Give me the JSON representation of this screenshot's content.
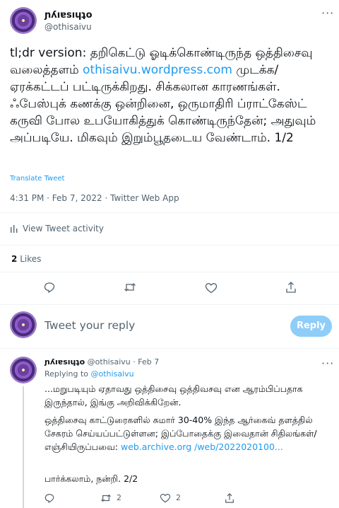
{
  "tweet": {
    "author_name": "ɲʎıɐsıɥʇo",
    "author_handle": "@othisaivu",
    "text_before_link": "tl;dr version: தறிகெட்டு ஓடிக்கொண்டிருந்த ஒத்திசைவு வலைத்தளம் ",
    "link": "othisaivu.wordpress.com",
    "text_after_link": " முடக்க/ஏரக்கட்டப் பட்டிருக்கிறது. சிக்கலான காரணங்கள். ஃபேஸ்புக் கணக்கு ஒன்றினை, ஒருமாதிரி ப்ராட்கேஸ்ட் கருவி போல உபயோகித்துக் கொண்டிருந்தேன்; அதுவும் அப்படியே. மிகவும் இறும்பூதடைய வேண்டாம். 1/2",
    "translate": "Translate Tweet",
    "meta": "4:31 PM · Feb 7, 2022 · Twitter Web App",
    "view_activity": "View Tweet activity",
    "likes_count": "2",
    "likes_label": "Likes"
  },
  "compose": {
    "placeholder": "Tweet your reply",
    "reply_button": "Reply"
  },
  "reply": {
    "author_name": "ɲʎıɐsıɥʇo",
    "author_handle": "@othisaivu",
    "date": "· Feb 7",
    "replying_to_label": "Replying to",
    "replying_to_handle": "@othisaivu",
    "para1": "...மறுபடியும் ஏதாவது ஒத்திசைவு ஒத்திவசவு என ஆரம்பிப்பதாக இருந்தால், இங்கு அறிவிக்கிறேன்.",
    "para2_before_link": "ஒத்திசைவு காட்டுரைகளில் சுமார் 30-40% இந்த ஆர்கைவ் தளத்தில் சேகரம் செய்யப்பட்டுள்ளன; இப்போதைக்கு இவைதான் சிதிலங்கள்/எஞ்சியிருப்பவை: ",
    "para2_link": "web.archive.org /web/2022020100...",
    "para3": "பார்க்கலாம், நன்றி. 2/2",
    "retweet_count": "2",
    "like_count": "2"
  }
}
